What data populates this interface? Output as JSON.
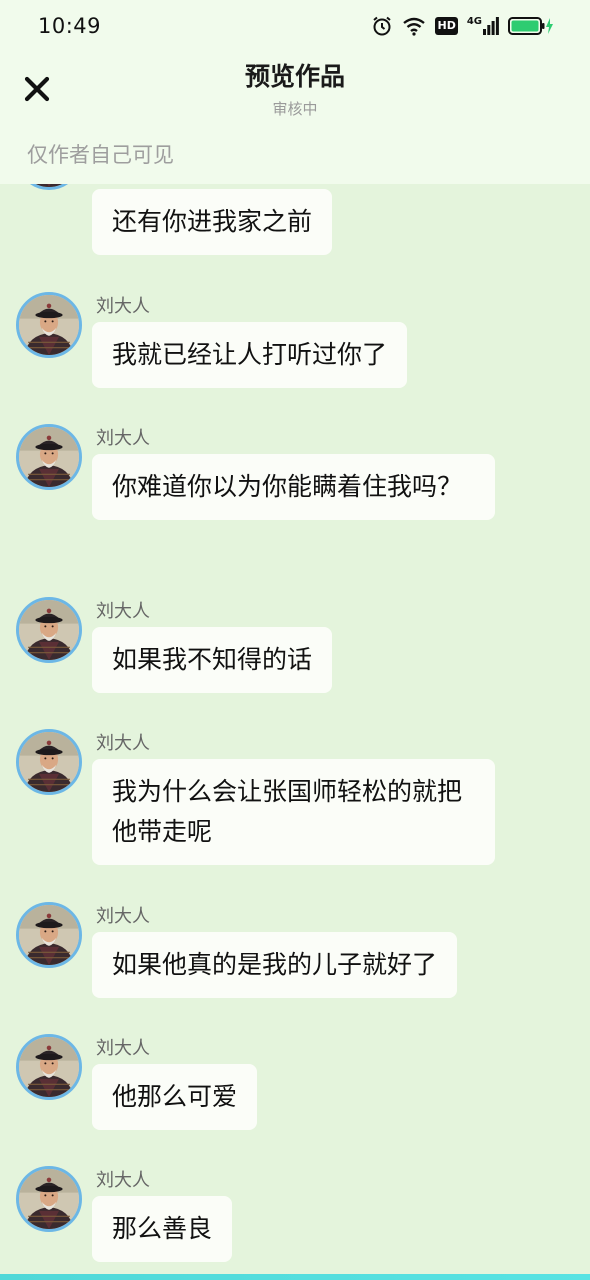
{
  "status_bar": {
    "time": "10:49",
    "icons": [
      "alarm-icon",
      "wifi-icon",
      "hd-icon",
      "signal-4g-icon",
      "battery-charging-icon"
    ],
    "hd_text": "HD",
    "network_text": "4G"
  },
  "header": {
    "title": "预览作品",
    "subtitle": "审核中",
    "visibility_note": "仅作者自己可见",
    "close_icon": "close-icon"
  },
  "colors": {
    "background": "#e4f4dc",
    "header_bg": "#f1fbec",
    "bubble_bg": "#fbfdf8",
    "avatar_ring": "#6cb7e6",
    "bottom_accent": "#4fd8d8",
    "battery": "#2ecc71"
  },
  "messages": [
    {
      "sender": "",
      "text": "还有你进我家之前"
    },
    {
      "sender": "刘大人",
      "text": "我就已经让人打听过你了"
    },
    {
      "sender": "刘大人",
      "text": "你难道你以为你能瞒着住我吗？"
    },
    {
      "sender": "刘大人",
      "text": "如果我不知得的话"
    },
    {
      "sender": "刘大人",
      "text": "我为什么会让张国师轻松的就把他带走呢"
    },
    {
      "sender": "刘大人",
      "text": "如果他真的是我的儿子就好了"
    },
    {
      "sender": "刘大人",
      "text": "他那么可爱"
    },
    {
      "sender": "刘大人",
      "text": "那么善良"
    }
  ]
}
